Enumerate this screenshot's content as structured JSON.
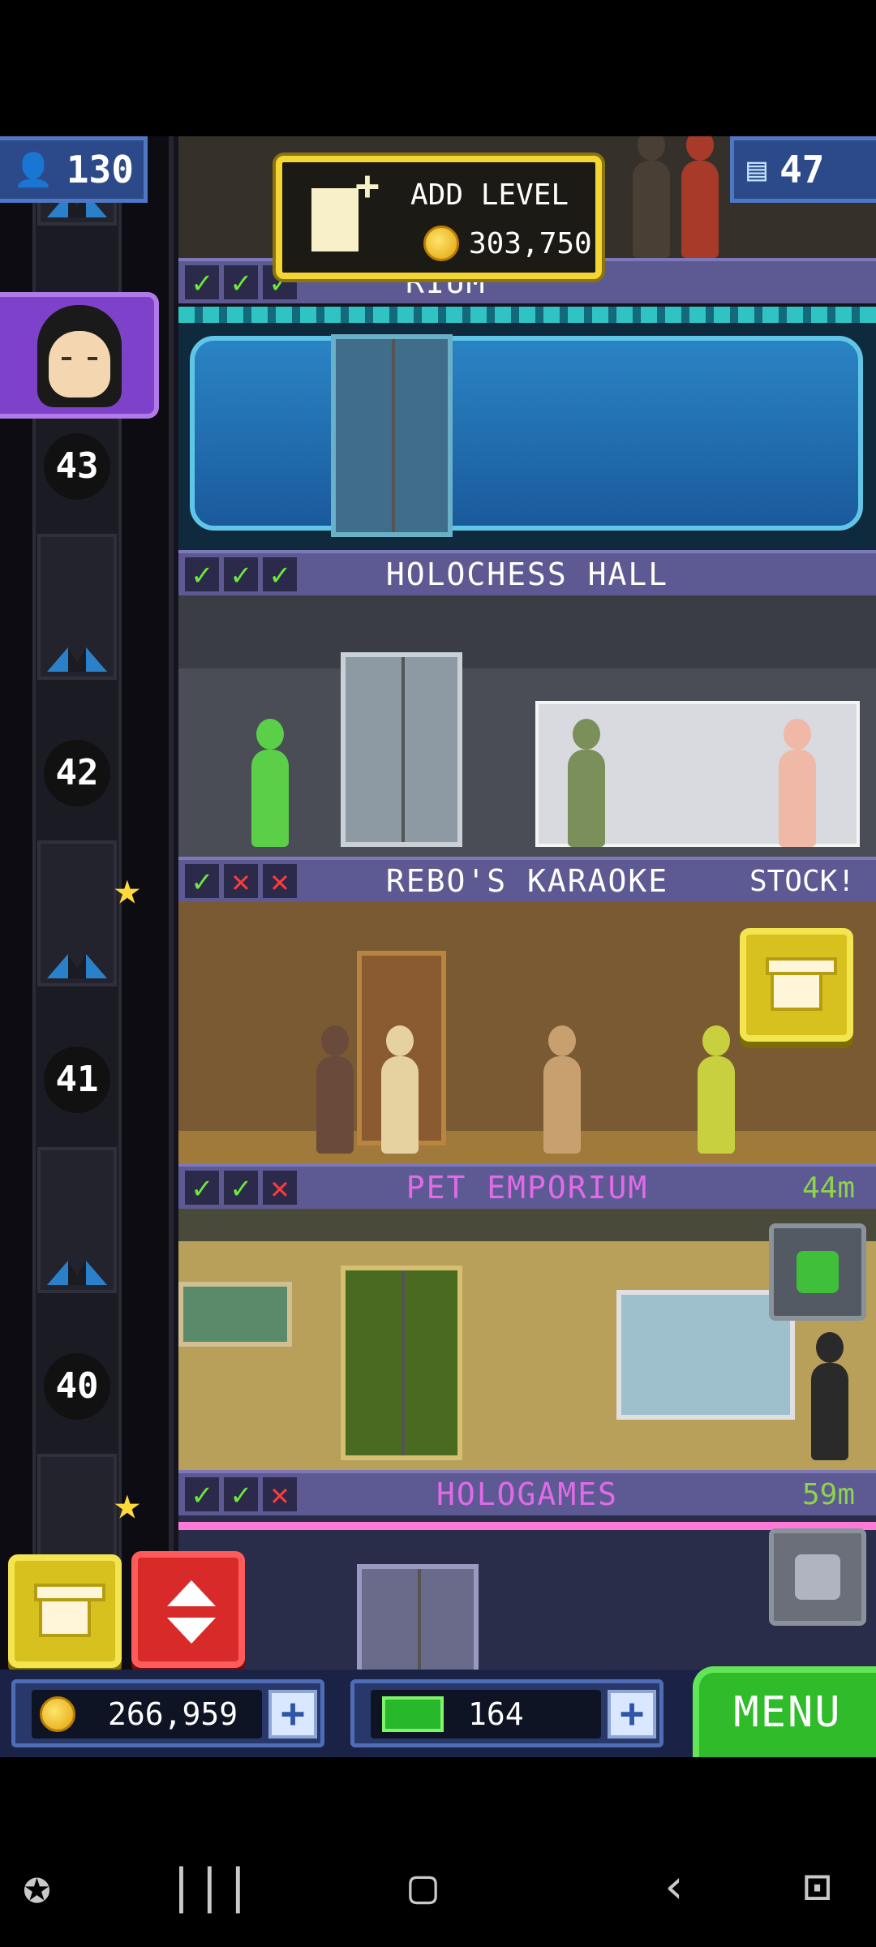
{
  "stats": {
    "population": "130",
    "floors": "47",
    "population_icon": "person-icon",
    "floors_icon": "building-icon"
  },
  "add_level": {
    "label": "ADD LEVEL",
    "cost": "303,750"
  },
  "floor_partial_label": "RIUM",
  "floor_numbers": [
    "43",
    "42",
    "41",
    "40"
  ],
  "floors": [
    {
      "name": "HOLOCHESS HALL",
      "extra": ""
    },
    {
      "name": "REBO'S KARAOKE",
      "extra": "STOCK!"
    },
    {
      "name": "PET EMPORIUM",
      "extra": "44m"
    },
    {
      "name": "HOLOGAMES",
      "extra": "59m"
    }
  ],
  "bottom": {
    "coins": "266,959",
    "bux": "164",
    "menu_label": "MENU"
  },
  "colors": {
    "coin": "#e1a30b",
    "accent_green": "#2fbb2a",
    "check_ok": "#6bea3b",
    "check_no": "#ff3b3b",
    "label_bar": "#5d5a93"
  },
  "icons": {
    "checks_top": [
      "check",
      "check",
      "check"
    ],
    "checks_holochess": [
      "check",
      "check",
      "check"
    ],
    "checks_karaoke": [
      "check",
      "cross",
      "cross"
    ],
    "checks_pet": [
      "check",
      "check",
      "cross"
    ],
    "checks_hologames": [
      "check",
      "check",
      "cross"
    ]
  }
}
